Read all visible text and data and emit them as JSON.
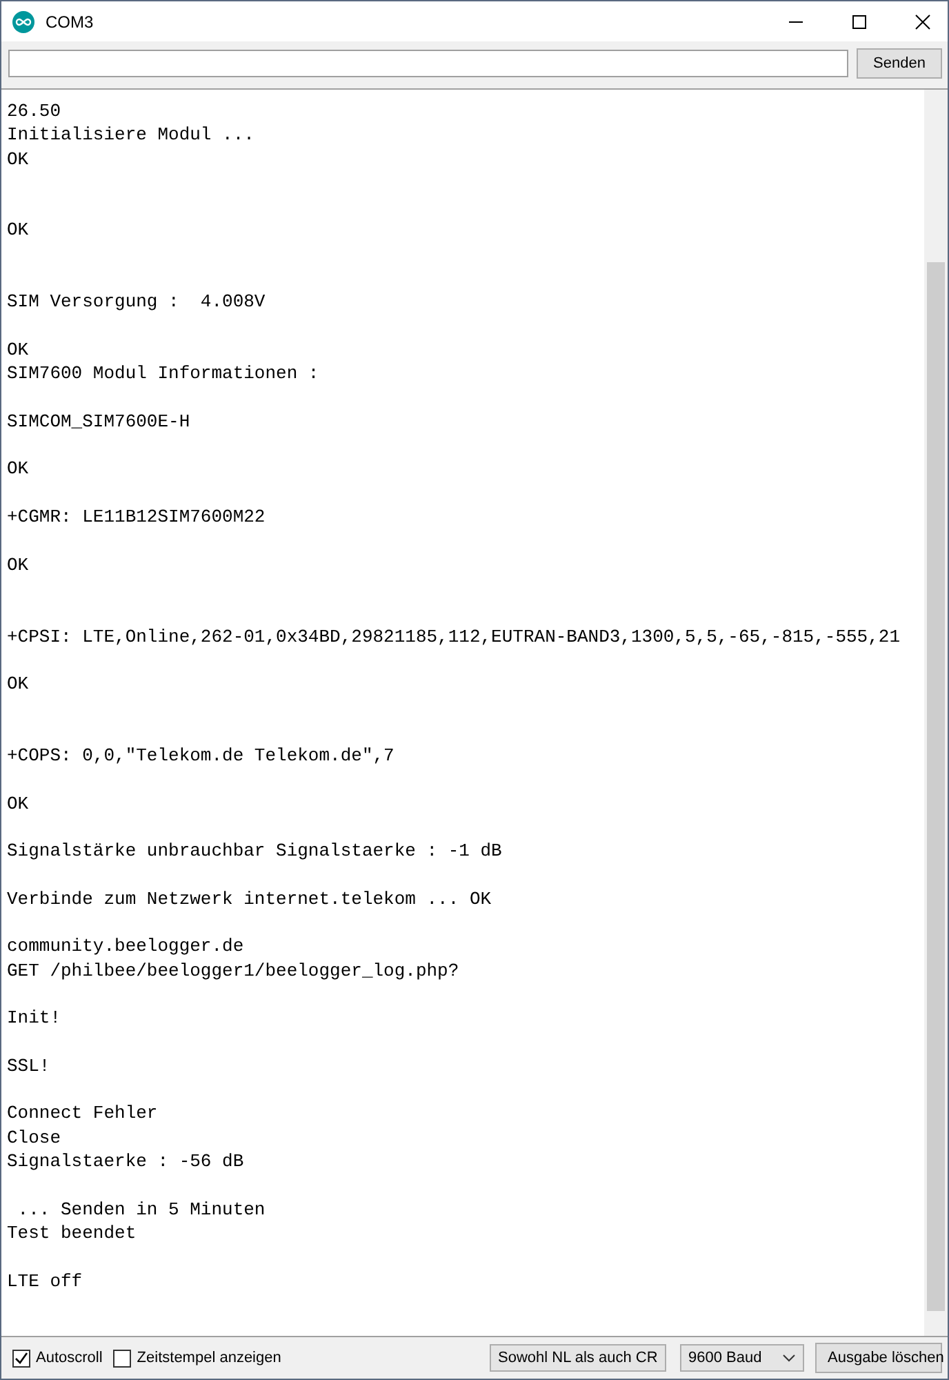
{
  "window": {
    "title": "COM3"
  },
  "send_button": "Senden",
  "lines": [
    {
      "kind": "text",
      "text": "26.50"
    },
    {
      "kind": "text",
      "text": "Initialisiere Modul ..."
    },
    {
      "kind": "text",
      "text": "OK"
    },
    {
      "kind": "blank"
    },
    {
      "kind": "blank"
    },
    {
      "kind": "text",
      "text": "OK"
    },
    {
      "kind": "blank"
    },
    {
      "kind": "blank"
    },
    {
      "kind": "text",
      "text": "SIM Versorgung :  4.008V"
    },
    {
      "kind": "blank"
    },
    {
      "kind": "text",
      "text": "OK"
    },
    {
      "kind": "text",
      "text": "SIM7600 Modul Informationen :"
    },
    {
      "kind": "blank"
    },
    {
      "kind": "text",
      "text": "SIMCOM_SIM7600E-H"
    },
    {
      "kind": "blank"
    },
    {
      "kind": "text",
      "text": "OK"
    },
    {
      "kind": "blank"
    },
    {
      "kind": "text",
      "text": "+CGMR: LE11B12SIM7600M22"
    },
    {
      "kind": "blank"
    },
    {
      "kind": "text",
      "text": "OK"
    },
    {
      "kind": "blank"
    },
    {
      "kind": "blank"
    },
    {
      "kind": "text",
      "text": "+CPSI: LTE,Online,262-01,0x34BD,29821185,112,EUTRAN-BAND3,1300,5,5,-65,-815,-555,21"
    },
    {
      "kind": "blank"
    },
    {
      "kind": "text",
      "text": "OK"
    },
    {
      "kind": "blank"
    },
    {
      "kind": "blank"
    },
    {
      "kind": "text",
      "text": "+COPS: 0,0,\"Telekom.de Telekom.de\",7"
    },
    {
      "kind": "blank"
    },
    {
      "kind": "text",
      "text": "OK"
    },
    {
      "kind": "blank"
    },
    {
      "kind": "text",
      "text": "Signalstärke unbrauchbar Signalstaerke : -1 dB"
    },
    {
      "kind": "blank"
    },
    {
      "kind": "text",
      "text": "Verbinde zum Netzwerk internet.telekom ... OK"
    },
    {
      "kind": "blank"
    },
    {
      "kind": "text",
      "text": "community.beelogger.de"
    },
    {
      "kind": "text",
      "text": "GET /philbee/beelogger1/beelogger_log.php?"
    },
    {
      "kind": "blank"
    },
    {
      "kind": "text",
      "text": "Init!"
    },
    {
      "kind": "blank"
    },
    {
      "kind": "text",
      "text": "SSL!"
    },
    {
      "kind": "blank"
    },
    {
      "kind": "text",
      "text": "Connect Fehler"
    },
    {
      "kind": "text",
      "text": "Close"
    },
    {
      "kind": "text",
      "text": "Signalstaerke : -56 dB"
    },
    {
      "kind": "blank"
    },
    {
      "kind": "text",
      "text": " ... Senden in 5 Minuten"
    },
    {
      "kind": "text",
      "text": "Test beendet"
    },
    {
      "kind": "blank"
    },
    {
      "kind": "text",
      "text": "LTE off"
    }
  ],
  "footer": {
    "autoscroll": {
      "label": "Autoscroll",
      "checked": true
    },
    "timestamp": {
      "label": "Zeitstempel anzeigen",
      "checked": false
    },
    "line_ending": "Sowohl NL als auch CR",
    "baud": "9600 Baud",
    "clear_button": "Ausgabe löschen"
  }
}
